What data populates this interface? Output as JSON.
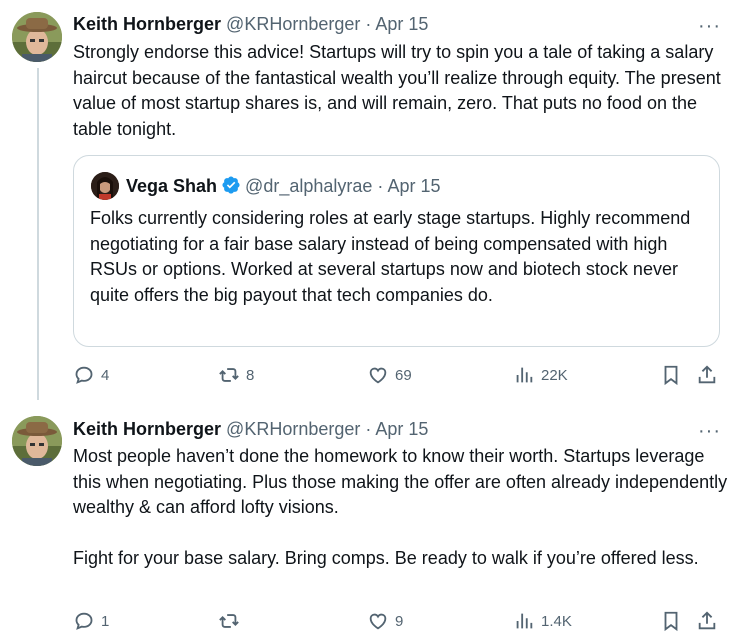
{
  "tweets": [
    {
      "author_name": "Keith Hornberger",
      "handle": "@KRHornberger",
      "separator": "·",
      "date": "Apr 15",
      "more": "···",
      "text": "Strongly endorse this advice! Startups will try to spin you a tale of taking a salary haircut because of the fantastical wealth you’ll realize through equity. The present value of most startup shares is, and will remain, zero. That puts no food on the table tonight.",
      "quote": {
        "author_name": "Vega Shah",
        "handle": "@dr_alphalyrae",
        "separator": "·",
        "date": "Apr 15",
        "text": "Folks currently considering roles at early stage startups. Highly recommend negotiating for a fair base salary instead of being compensated with high RSUs or options. Worked at several startups now and biotech stock never quite offers the big payout that tech companies do."
      },
      "actions": {
        "replies": "4",
        "reposts": "8",
        "likes": "69",
        "views": "22K"
      }
    },
    {
      "author_name": "Keith Hornberger",
      "handle": "@KRHornberger",
      "separator": "·",
      "date": "Apr 15",
      "more": "···",
      "text": "Most people haven’t done the homework to know their worth. Startups leverage this when negotiating. Plus those making the offer are often already independently wealthy & can afford lofty visions.\n\nFight for your base salary. Bring comps. Be ready to walk if you’re offered less.",
      "actions": {
        "replies": "1",
        "reposts": "",
        "likes": "9",
        "views": "1.4K"
      }
    }
  ],
  "colors": {
    "text": "#0f1419",
    "secondary": "#536471",
    "border": "#cfd9de",
    "verified": "#1d9bf0"
  }
}
